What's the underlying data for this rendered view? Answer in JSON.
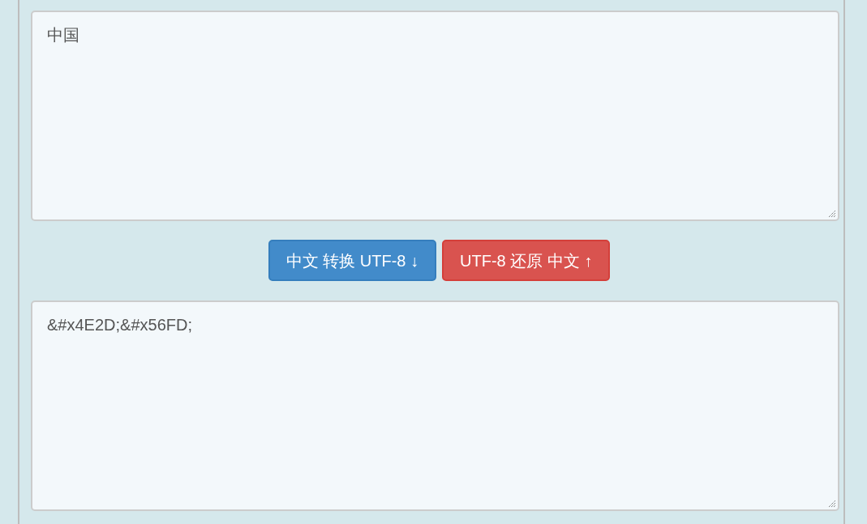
{
  "input": {
    "value": "中国"
  },
  "buttons": [
    {
      "label": "中文 转换 UTF-8 ↓",
      "kind": "encode"
    },
    {
      "label": "UTF-8 还原 中文 ↑",
      "kind": "decode"
    }
  ],
  "output": {
    "value": "&#x4E2D;&#x56FD;"
  }
}
